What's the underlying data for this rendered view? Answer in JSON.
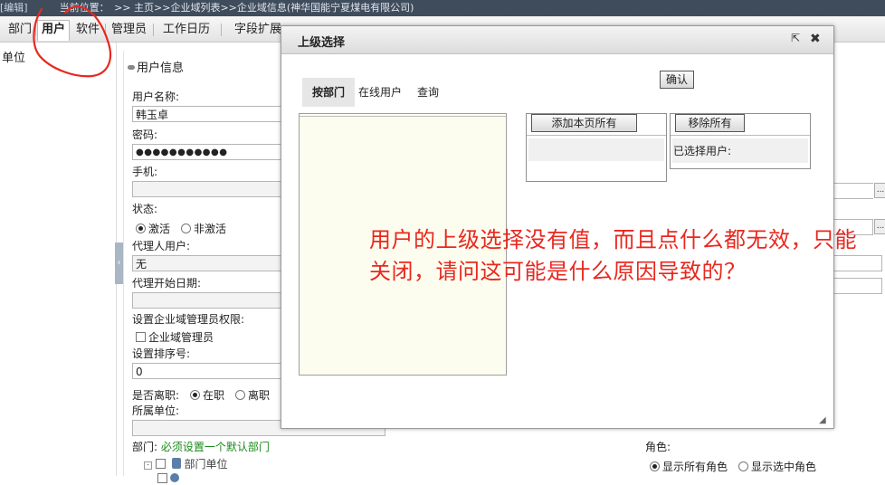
{
  "topbar": {
    "edit_link": "[编辑]",
    "location_label": "当前位置：",
    "path": ">> 主页>>企业域列表>>企业域信息(神华国能宁夏煤电有限公司)"
  },
  "tabs": [
    {
      "label": "部门",
      "active": false
    },
    {
      "label": "用户",
      "active": true
    },
    {
      "label": "软件",
      "active": false
    },
    {
      "label": "管理员",
      "active": false
    },
    {
      "label": "工作日历",
      "active": false
    },
    {
      "label": "字段扩展",
      "active": false
    }
  ],
  "left_panel": {
    "item": "单位"
  },
  "user_panel": {
    "title": "用户信息",
    "username_label": "用户名称:",
    "username_value": "韩玉卓",
    "password_label": "密码:",
    "password_value": "●●●●●●●●●●●",
    "phone_label": "手机:",
    "phone_value": "",
    "status_label": "状态:",
    "status_options": [
      "激活",
      "非激活"
    ],
    "status_selected": "激活",
    "proxy_user_label": "代理人用户:",
    "proxy_user_value": "无",
    "proxy_start_label": "代理开始日期:",
    "proxy_start_value": "",
    "admin_perm_label": "设置企业域管理员权限:",
    "admin_perm_option": "企业域管理员",
    "sort_label": "设置排序号:",
    "sort_value": "0",
    "resigned_label": "是否离职:",
    "resigned_options": [
      "在职",
      "离职"
    ],
    "resigned_selected": "在职",
    "unit_label": "所属单位:",
    "unit_value": "",
    "dept_label": "部门:",
    "dept_hint": "必须设置一个默认部门",
    "dept_tree_item": "部门单位",
    "role_label": "角色:",
    "role_options": [
      "显示所有角色",
      "显示选中角色"
    ],
    "role_selected": "显示所有角色",
    "ellipsis": "..."
  },
  "modal": {
    "title": "上级选择",
    "tabs": [
      {
        "label": "按部门",
        "active": true
      },
      {
        "label": "在线用户",
        "active": false
      },
      {
        "label": "查询",
        "active": false
      }
    ],
    "confirm_label": "确认",
    "add_all_label": "添加本页所有",
    "remove_all_label": "移除所有",
    "selected_users_label": "已选择用户:"
  },
  "annotation": {
    "text": "用户的上级选择没有值，而且点什么都无效，只能关闭，请问这可能是什么原因导致的？"
  },
  "colors": {
    "annotation_red": "#e8281f",
    "topbar_bg": "#3f4c5c",
    "tree_bg": "#fdfdef",
    "hint_green": "#1a8a1a"
  }
}
